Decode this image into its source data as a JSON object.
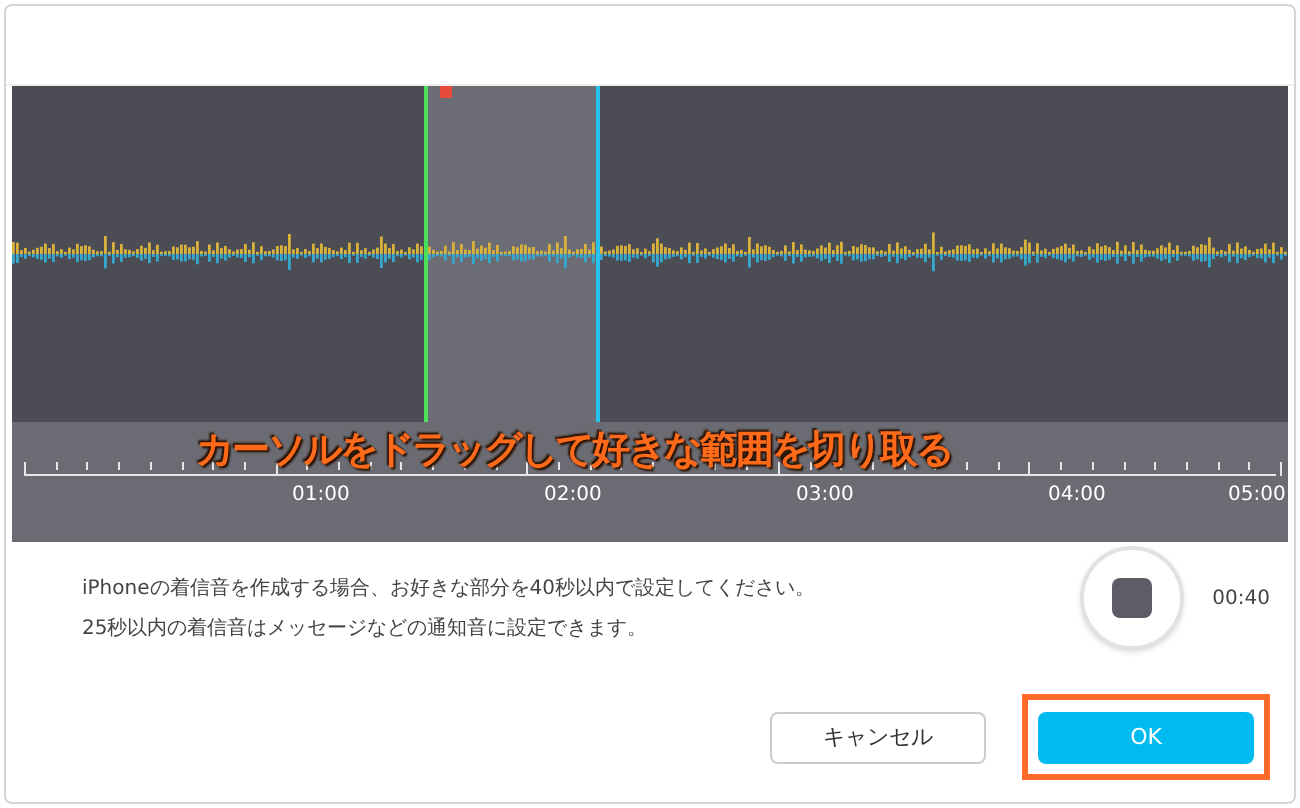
{
  "waveform": {
    "caption": "カーソルをドラッグして好きな範囲を切り取る",
    "time_labels": [
      "01:00",
      "02:00",
      "03:00",
      "04:00",
      "05:00"
    ]
  },
  "info": {
    "lines": [
      "iPhoneの着信音を作成する場合、お好きな部分を40秒以内で設定してください。",
      "25秒以内の着信音はメッセージなどの通知音に設定できます。"
    ],
    "duration": "00:40"
  },
  "buttons": [
    {
      "label": "キャンセル",
      "kind": "secondary",
      "highlighted": false
    },
    {
      "label": "OK",
      "kind": "primary",
      "highlighted": true
    }
  ]
}
